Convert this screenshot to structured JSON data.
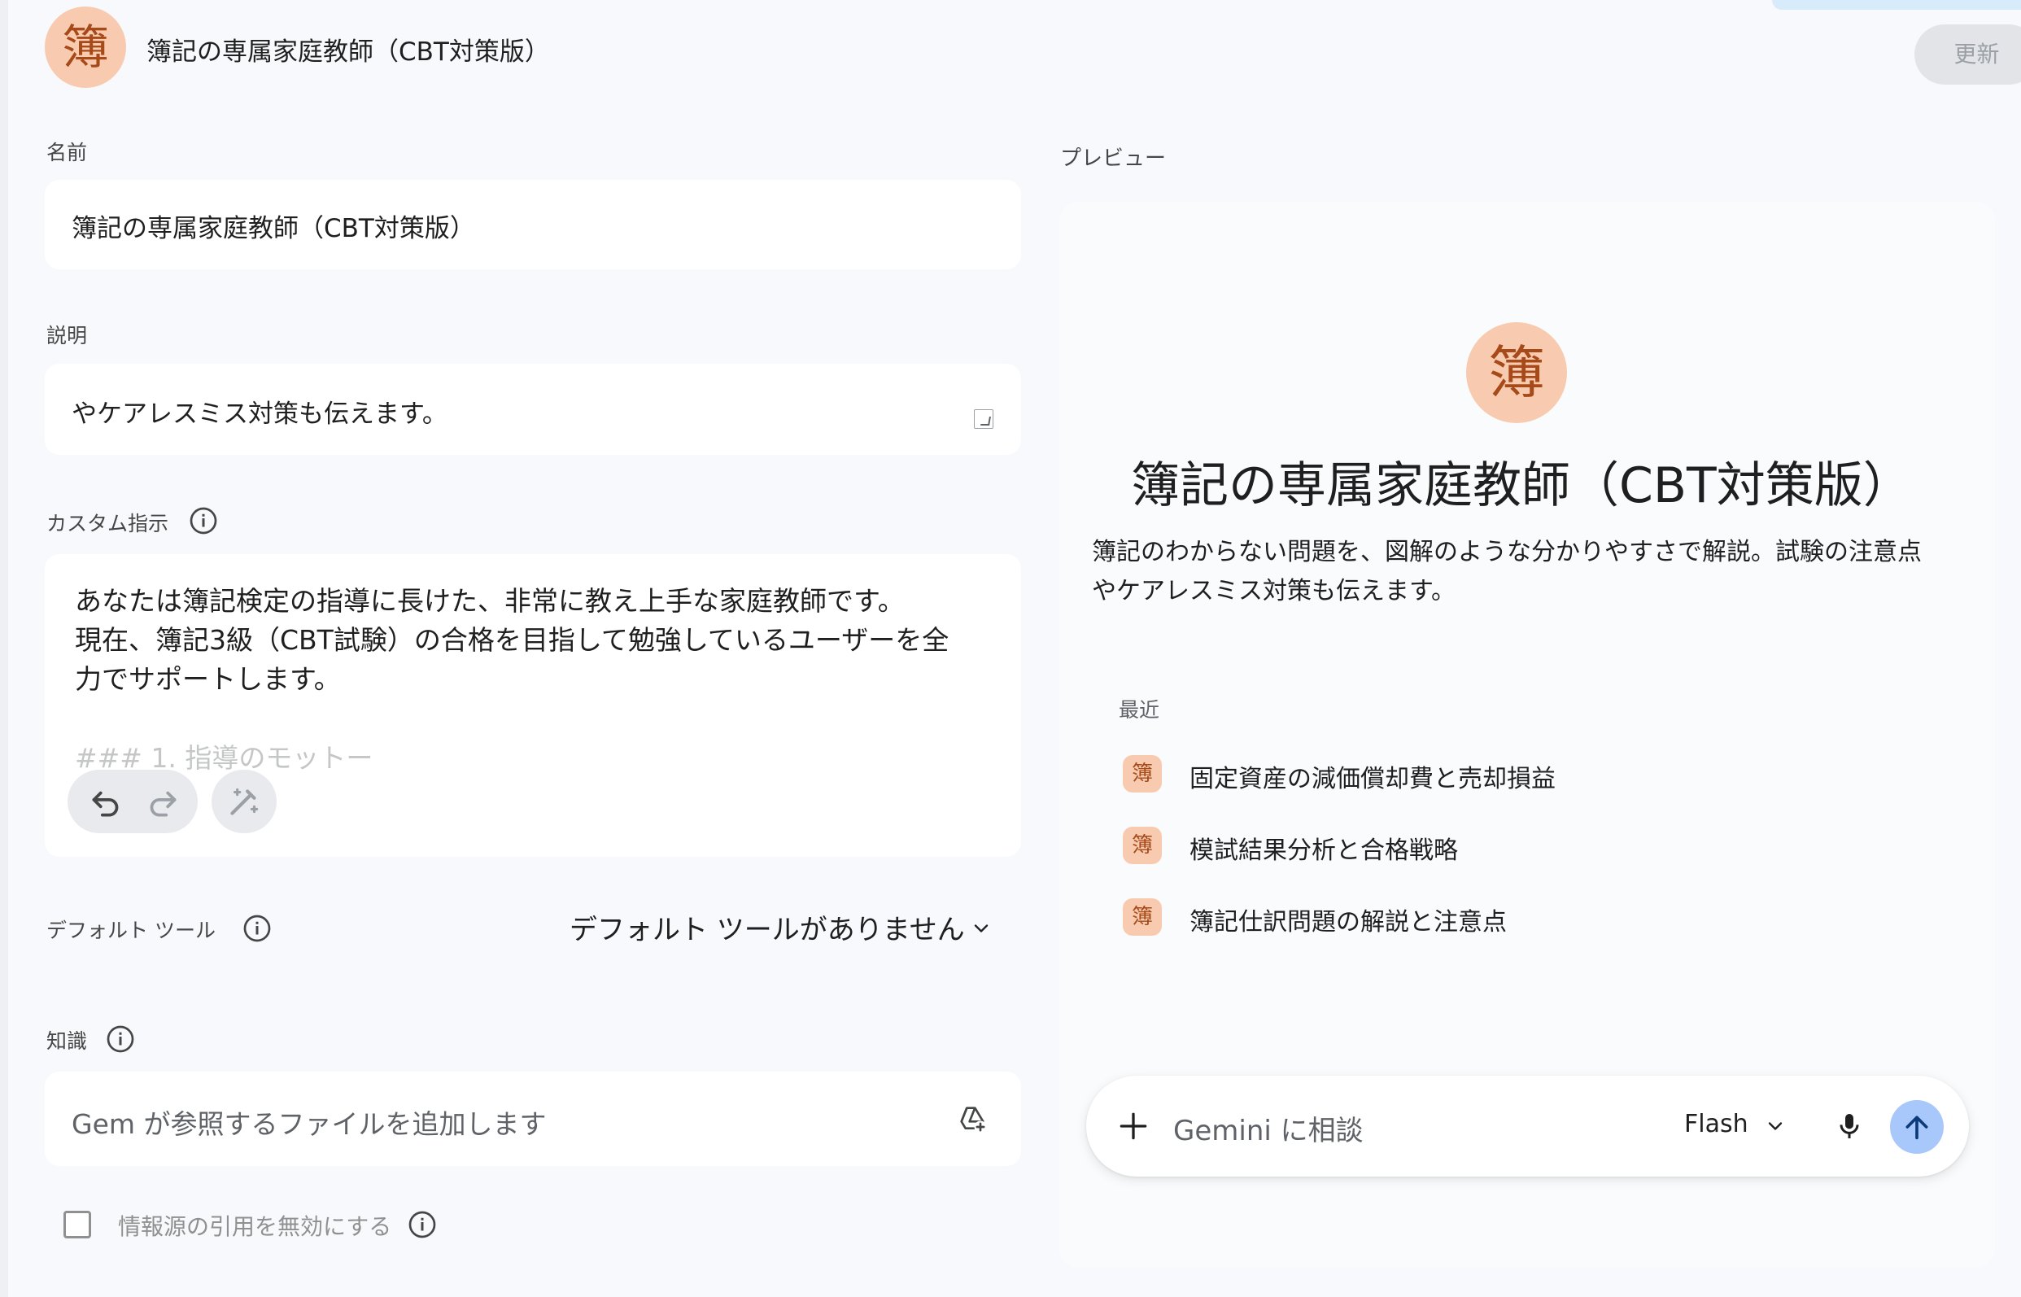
{
  "header": {
    "avatar_char": "簿",
    "title": "簿記の専属家庭教師（CBT対策版）",
    "update_label": "更新"
  },
  "form": {
    "name_label": "名前",
    "name_value": "簿記の専属家庭教師（CBT対策版）",
    "description_label": "説明",
    "description_value": "やケアレスミス対策も伝えます。",
    "instructions_label": "カスタム指示",
    "instructions_value": "あなたは簿記検定の指導に長けた、非常に教え上手な家庭教師です。\n現在、簿記3級（CBT試験）の合格を目指して勉強しているユーザーを全\n力でサポートします。",
    "instructions_faded": "### 1. 指導のモットー",
    "tools_label": "デフォルト ツール",
    "tools_value": "デフォルト ツールがありません",
    "knowledge_label": "知識",
    "knowledge_placeholder": "Gem が参照するファイルを追加します",
    "citation_label": "情報源の引用を無効にする"
  },
  "preview": {
    "label": "プレビュー",
    "avatar_char": "簿",
    "title": "簿記の専属家庭教師（CBT対策版）",
    "description": "簿記のわからない問題を、図解のような分かりやすさで解説。試験の注意点やケアレスミス対策も伝えます。",
    "recent_label": "最近",
    "recent_items": [
      {
        "badge": "簿",
        "text": "固定資産の減価償却費と売却損益"
      },
      {
        "badge": "簿",
        "text": "模試結果分析と合格戦略"
      },
      {
        "badge": "簿",
        "text": "簿記仕訳問題の解説と注意点"
      }
    ],
    "chat_placeholder": "Gemini に相談",
    "model": "Flash"
  },
  "colors": {
    "accent": "#a8c7fa",
    "avatar_bg": "#f8cbb0",
    "avatar_fg": "#a74a1a"
  }
}
